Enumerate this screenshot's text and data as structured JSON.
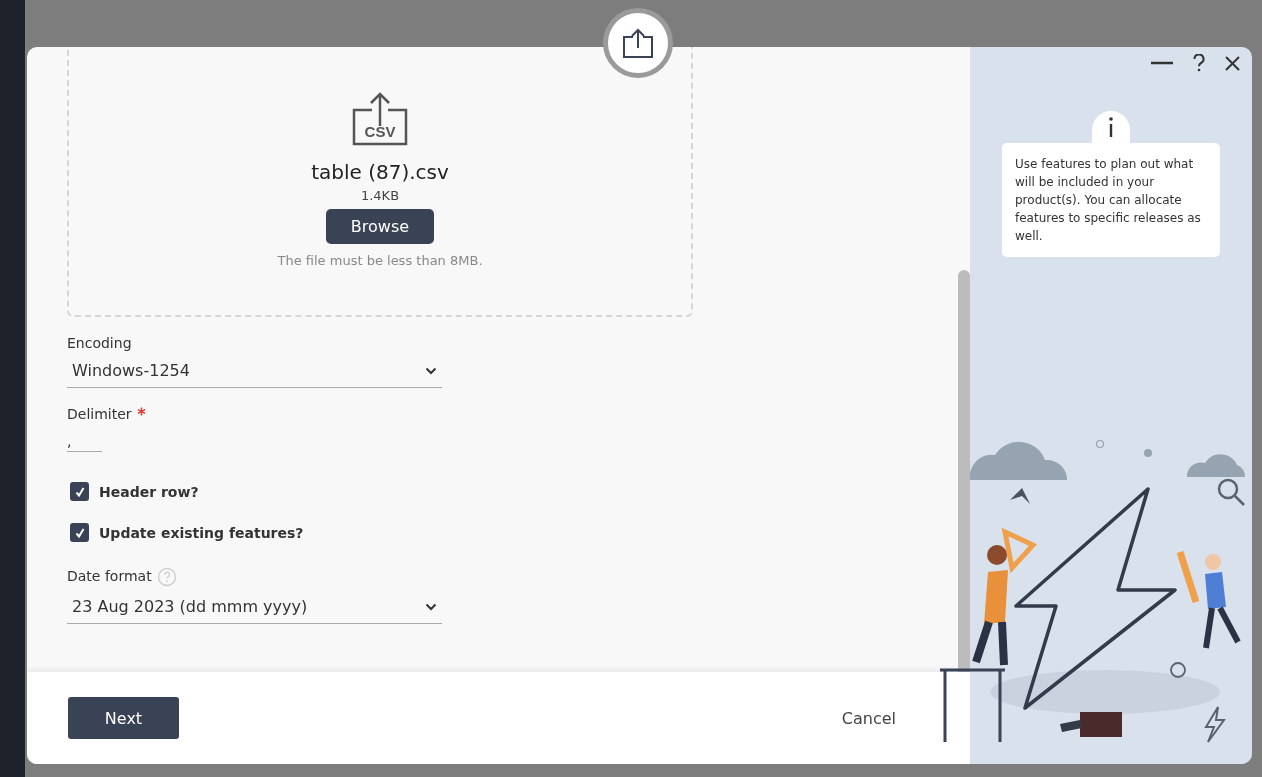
{
  "dialog": {
    "upload": {
      "icon_label": "CSV",
      "file_name": "table (87).csv",
      "file_size": "1.4KB",
      "browse_button": "Browse",
      "hint": "The file must be less than 8MB."
    },
    "fields": [
      {
        "kind": "select",
        "label": "Encoding",
        "value": "Windows-1254"
      },
      {
        "kind": "text",
        "label": "Delimiter",
        "required": true,
        "value": ","
      },
      {
        "kind": "checkbox",
        "label": "Header row?",
        "checked": true
      },
      {
        "kind": "checkbox",
        "label": "Update existing features?",
        "checked": true
      },
      {
        "kind": "select",
        "label": "Date format",
        "help": true,
        "value": "23 Aug 2023 (dd mmm yyyy)"
      }
    ],
    "footer": {
      "next_button": "Next",
      "cancel_button": "Cancel"
    },
    "side_panel": {
      "info": "Use features to plan out what will be included in your product(s). You can allocate features to specific releases as well."
    }
  }
}
